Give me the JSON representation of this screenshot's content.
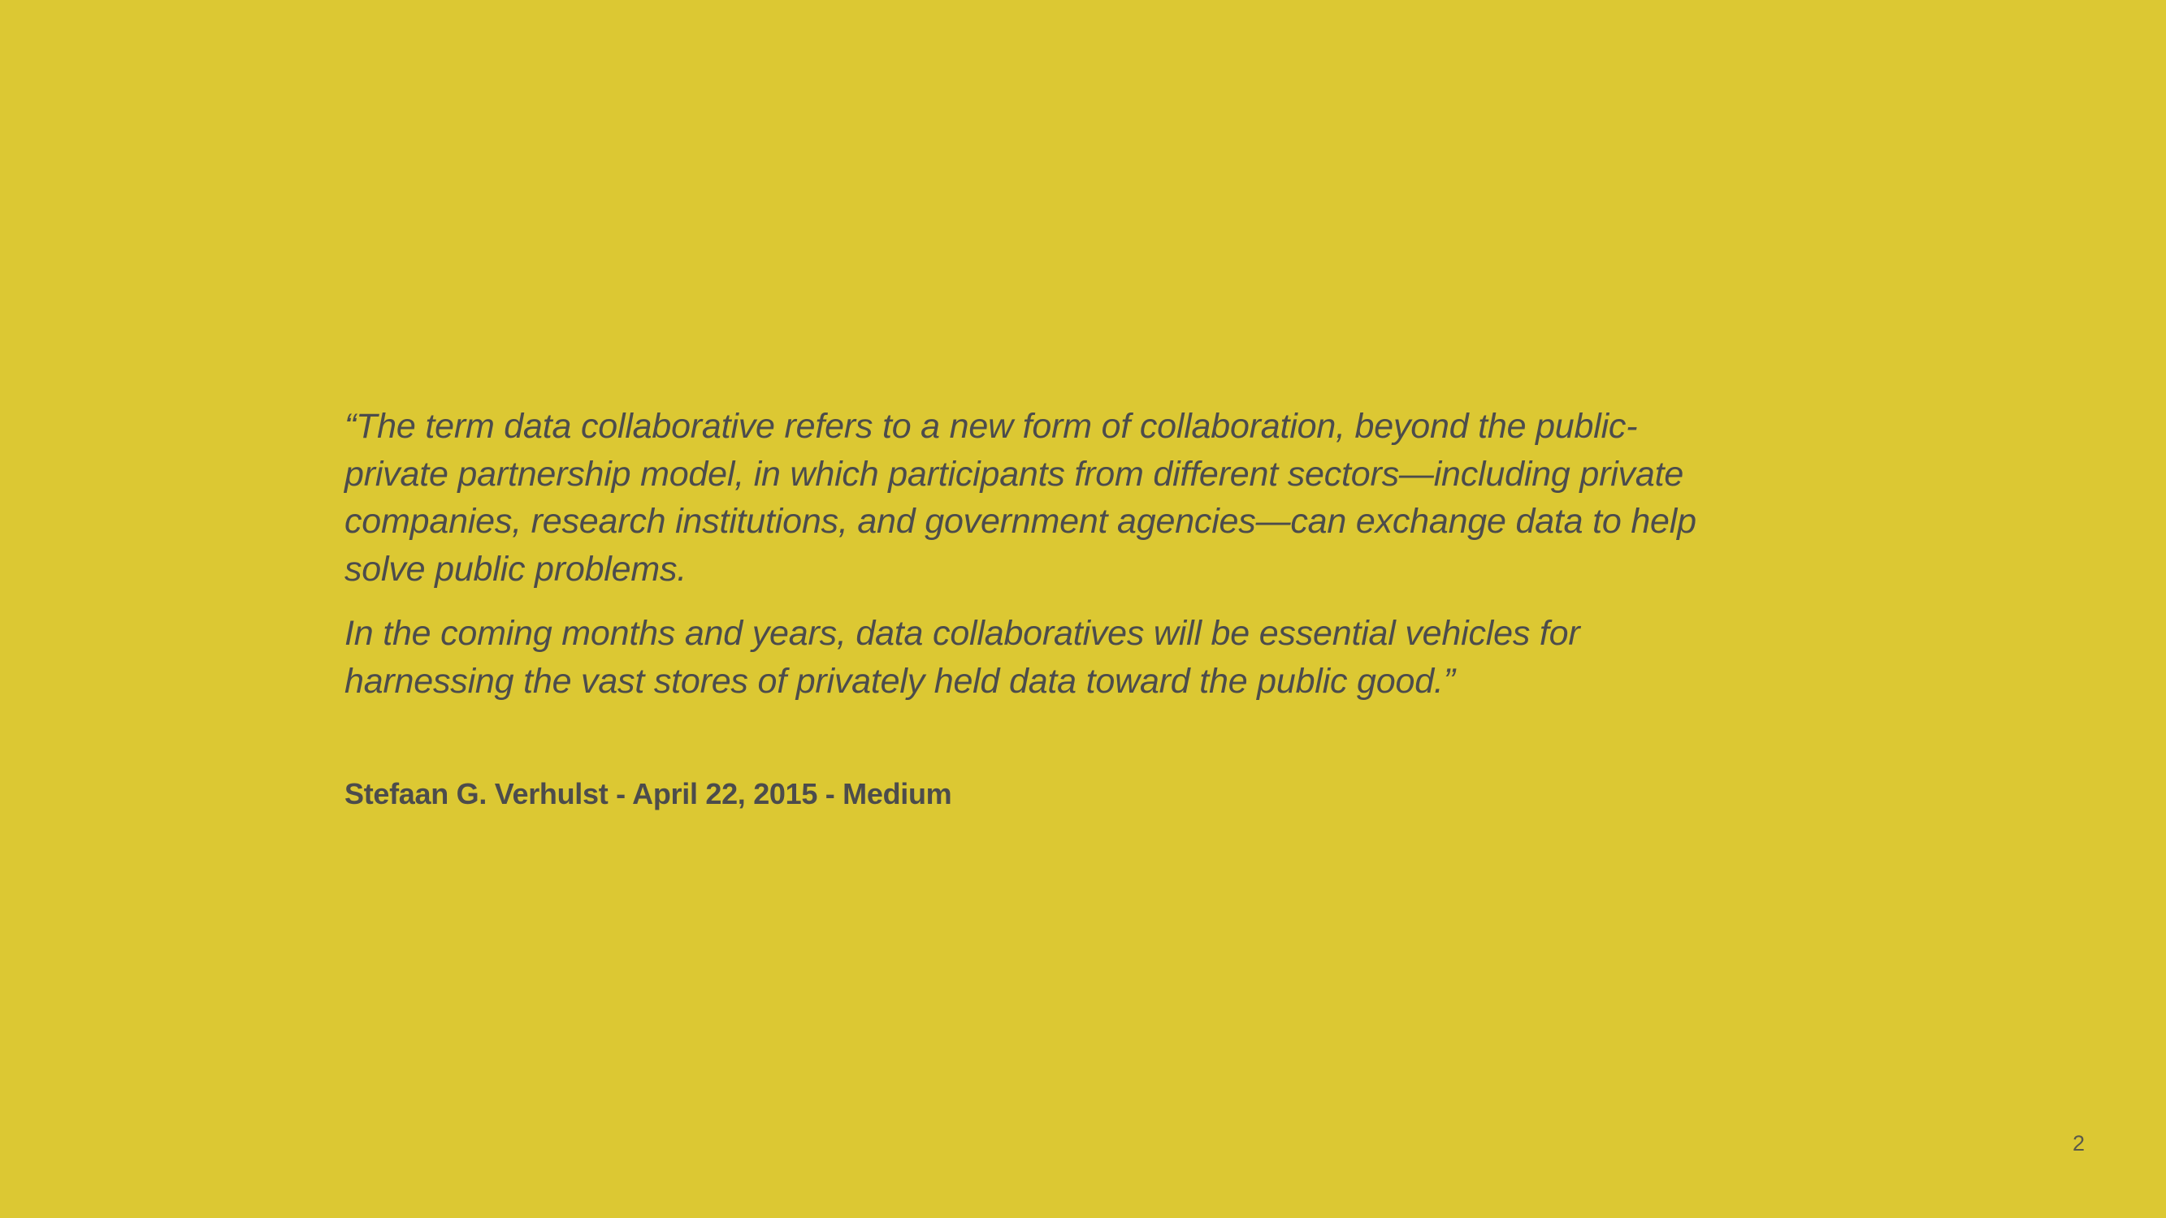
{
  "quote": {
    "lines_para1": [
      "“The term data collaborative refers to a new form of collaboration, beyond the public-",
      "private partnership model, in which participants from different sectors—including private",
      "companies, research institutions, and government agencies—can exchange data to help",
      "solve public problems."
    ],
    "lines_para2": [
      "In the coming months and years, data collaboratives will be essential vehicles for",
      "harnessing the vast stores of privately held data toward the public good.”"
    ]
  },
  "attribution": "Stefaan G. Verhulst  - April 22, 2015 - Medium",
  "page_number": "2",
  "colors": {
    "background": "#DCC833",
    "text": "#4C4C4C"
  }
}
